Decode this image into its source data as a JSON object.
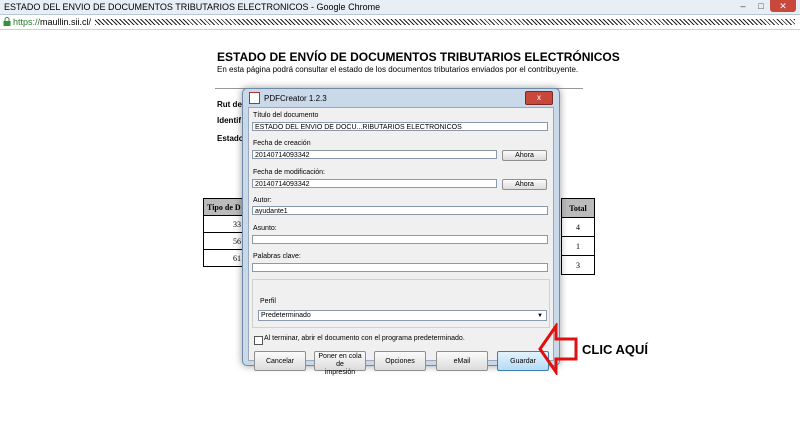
{
  "browser": {
    "title": "ESTADO DEL ENVIO DE DOCUMENTOS TRIBUTARIOS ELECTRONICOS - Google Chrome",
    "url_scheme": "https://",
    "url_host": "maullin.sii.cl",
    "url_tail": "/",
    "min_label": "–",
    "max_label": "□",
    "close_label": "✕"
  },
  "page": {
    "heading": "ESTADO DE ENVÍO DE DOCUMENTOS TRIBUTARIOS ELECTRÓNICOS",
    "subheading": "En esta página podrá consultar el estado de los documentos tributarios enviados por el contribuyente.",
    "field_rut": "Rut de",
    "field_ident": "Identif",
    "field_estado": "Estado",
    "table_col_tipo": "Tipo de D",
    "table_rows_tipo": [
      "33",
      "56",
      "61"
    ],
    "table_col_total": "Total",
    "table_rows_total": [
      "4",
      "1",
      "3"
    ]
  },
  "dialog": {
    "title": "PDFCreator 1.2.3",
    "close_label": "x",
    "doc_title_label": "Título del documento",
    "doc_title_value": "ESTADO DEL ENVIO DE DOCU...RIBUTARIOS ELECTRONICOS",
    "created_label": "Fecha de creación",
    "created_value": "20140714093342",
    "modified_label": "Fecha de modificación:",
    "modified_value": "20140714093342",
    "now_button": "Ahora",
    "author_label": "Autor:",
    "author_value": "ayudante1",
    "subject_label": "Asunto:",
    "subject_value": "",
    "keywords_label": "Palabras clave:",
    "keywords_value": "",
    "profile_label": "Perfil",
    "profile_value": "Predeterminado",
    "open_after_label": "Al terminar, abrir el documento con el programa predeterminado.",
    "buttons": {
      "cancel": "Cancelar",
      "queue_line1": "Poner en cola de",
      "queue_line2": "impresión",
      "options": "Opciones",
      "email": "eMail",
      "save": "Guardar"
    }
  },
  "annotation": {
    "text": "CLIC AQUÍ",
    "arrow_color": "#e01010"
  }
}
